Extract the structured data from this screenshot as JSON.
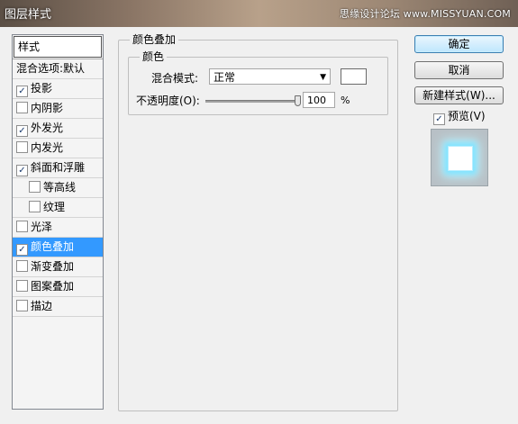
{
  "window": {
    "title": "图层样式",
    "watermark": "思缘设计论坛 www.MISSYUAN.COM"
  },
  "styles_list": {
    "header": "样式",
    "blend_options": "混合选项:默认",
    "items": [
      {
        "label": "投影",
        "checked": true,
        "indent": false,
        "selected": false
      },
      {
        "label": "内阴影",
        "checked": false,
        "indent": false,
        "selected": false
      },
      {
        "label": "外发光",
        "checked": true,
        "indent": false,
        "selected": false
      },
      {
        "label": "内发光",
        "checked": false,
        "indent": false,
        "selected": false
      },
      {
        "label": "斜面和浮雕",
        "checked": true,
        "indent": false,
        "selected": false
      },
      {
        "label": "等高线",
        "checked": false,
        "indent": true,
        "selected": false
      },
      {
        "label": "纹理",
        "checked": false,
        "indent": true,
        "selected": false
      },
      {
        "label": "光泽",
        "checked": false,
        "indent": false,
        "selected": false
      },
      {
        "label": "颜色叠加",
        "checked": true,
        "indent": false,
        "selected": true
      },
      {
        "label": "渐变叠加",
        "checked": false,
        "indent": false,
        "selected": false
      },
      {
        "label": "图案叠加",
        "checked": false,
        "indent": false,
        "selected": false
      },
      {
        "label": "描边",
        "checked": false,
        "indent": false,
        "selected": false
      }
    ]
  },
  "color_overlay": {
    "group_title": "颜色叠加",
    "sub_title": "颜色",
    "blend_mode_label": "混合模式:",
    "blend_mode_value": "正常",
    "overlay_color": "#ffffff",
    "opacity_label": "不透明度(O):",
    "opacity_value": "100",
    "opacity_unit": "%",
    "opacity_fraction": 1.0
  },
  "actions": {
    "ok": "确定",
    "cancel": "取消",
    "new_style": "新建样式(W)...",
    "preview_label": "预览(V)",
    "preview_checked": true
  },
  "colors": {
    "selection": "#3399ff",
    "glow": "#7fe3ff"
  }
}
